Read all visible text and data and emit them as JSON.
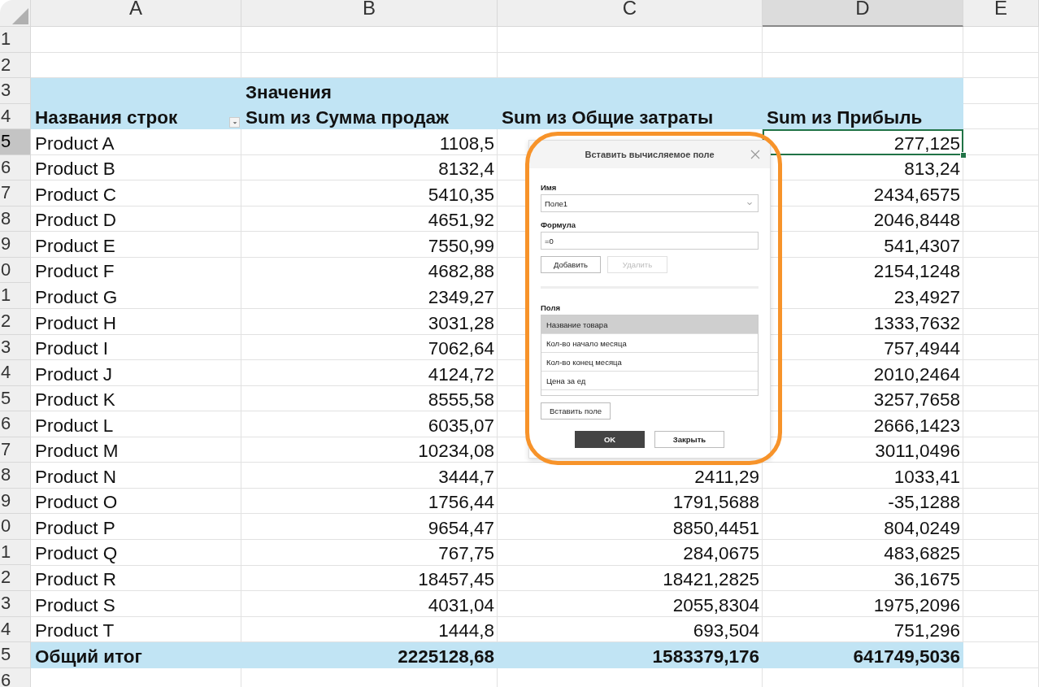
{
  "columns": [
    {
      "letter": "A",
      "selected": false
    },
    {
      "letter": "B",
      "selected": false
    },
    {
      "letter": "C",
      "selected": false
    },
    {
      "letter": "D",
      "selected": true
    },
    {
      "letter": "E",
      "selected": false
    }
  ],
  "rows": [
    {
      "number": "1",
      "kind": "empty",
      "selected": false
    },
    {
      "number": "2",
      "kind": "empty",
      "selected": false
    },
    {
      "number": "3",
      "kind": "header",
      "selected": false,
      "b": "Значения"
    },
    {
      "number": "4",
      "kind": "header",
      "selected": false,
      "a": "Названия строк",
      "b": "Sum из Сумма продаж",
      "c": "Sum из Общие затраты",
      "d": "Sum из Прибыль"
    },
    {
      "number": "5",
      "kind": "data",
      "selected": true,
      "a": "Product A",
      "b": "1108,5",
      "d": "277,125"
    },
    {
      "number": "6",
      "kind": "data",
      "selected": false,
      "a": "Product B",
      "b": "8132,4",
      "d": "813,24"
    },
    {
      "number": "7",
      "kind": "data",
      "selected": false,
      "a": "Product C",
      "b": "5410,35",
      "d": "2434,6575"
    },
    {
      "number": "8",
      "kind": "data",
      "selected": false,
      "a": "Product D",
      "b": "4651,92",
      "d": "2046,8448"
    },
    {
      "number": "9",
      "kind": "data",
      "selected": false,
      "a": "Product E",
      "b": "7550,99",
      "d": "541,4307"
    },
    {
      "number": "0",
      "kind": "data",
      "selected": false,
      "a": "Product F",
      "b": "4682,88",
      "d": "2154,1248"
    },
    {
      "number": "1",
      "kind": "data",
      "selected": false,
      "a": "Product G",
      "b": "2349,27",
      "d": "23,4927"
    },
    {
      "number": "2",
      "kind": "data",
      "selected": false,
      "a": "Product H",
      "b": "3031,28",
      "d": "1333,7632"
    },
    {
      "number": "3",
      "kind": "data",
      "selected": false,
      "a": "Product I",
      "b": "7062,64",
      "d": "757,4944"
    },
    {
      "number": "4",
      "kind": "data",
      "selected": false,
      "a": "Product J",
      "b": "4124,72",
      "d": "2010,2464"
    },
    {
      "number": "5",
      "kind": "data",
      "selected": false,
      "a": "Product K",
      "b": "8555,58",
      "d": "3257,7658"
    },
    {
      "number": "6",
      "kind": "data",
      "selected": false,
      "a": "Product L",
      "b": "6035,07",
      "d": "2666,1423"
    },
    {
      "number": "7",
      "kind": "data",
      "selected": false,
      "a": "Product M",
      "b": "10234,08",
      "d": "3011,0496"
    },
    {
      "number": "8",
      "kind": "data",
      "selected": false,
      "a": "Product N",
      "b": "3444,7",
      "c": "2411,29",
      "d": "1033,41"
    },
    {
      "number": "9",
      "kind": "data",
      "selected": false,
      "a": "Product O",
      "b": "1756,44",
      "c": "1791,5688",
      "d": "-35,1288"
    },
    {
      "number": "0",
      "kind": "data",
      "selected": false,
      "a": "Product P",
      "b": "9654,47",
      "c": "8850,4451",
      "d": "804,0249"
    },
    {
      "number": "1",
      "kind": "data",
      "selected": false,
      "a": "Product Q",
      "b": "767,75",
      "c": "284,0675",
      "d": "483,6825"
    },
    {
      "number": "2",
      "kind": "data",
      "selected": false,
      "a": "Product R",
      "b": "18457,45",
      "c": "18421,2825",
      "d": "36,1675"
    },
    {
      "number": "3",
      "kind": "data",
      "selected": false,
      "a": "Product S",
      "b": "4031,04",
      "c": "2055,8304",
      "d": "1975,2096"
    },
    {
      "number": "4",
      "kind": "data",
      "selected": false,
      "a": "Product T",
      "b": "1444,8",
      "c": "693,504",
      "d": "751,296"
    },
    {
      "number": "5",
      "kind": "total",
      "selected": false,
      "a": "Общий итог",
      "b": "2225128,68",
      "c": "1583379,176",
      "d": "641749,5036"
    },
    {
      "number": "6",
      "kind": "empty",
      "selected": false
    }
  ],
  "dialog": {
    "title": "Вставить вычисляемое поле",
    "fields": [
      {
        "label": "Имя",
        "value": "Поле1",
        "kind": "dropdown"
      },
      {
        "label": "Формула",
        "value": "=0",
        "kind": "text"
      }
    ],
    "buttons": [
      {
        "label": "Добавить",
        "disabled": false
      },
      {
        "label": "Удалить",
        "disabled": true
      }
    ],
    "list_label": "Поля",
    "list_items": [
      {
        "label": "Название товара",
        "selected": true
      },
      {
        "label": "Кол-во начало месяца",
        "selected": false
      },
      {
        "label": "Кол-во конец месяца",
        "selected": false
      },
      {
        "label": "Цена за ед",
        "selected": false
      }
    ],
    "insert_button": "Вставить поле",
    "ok_button": "OK",
    "close_button": "Закрыть"
  }
}
